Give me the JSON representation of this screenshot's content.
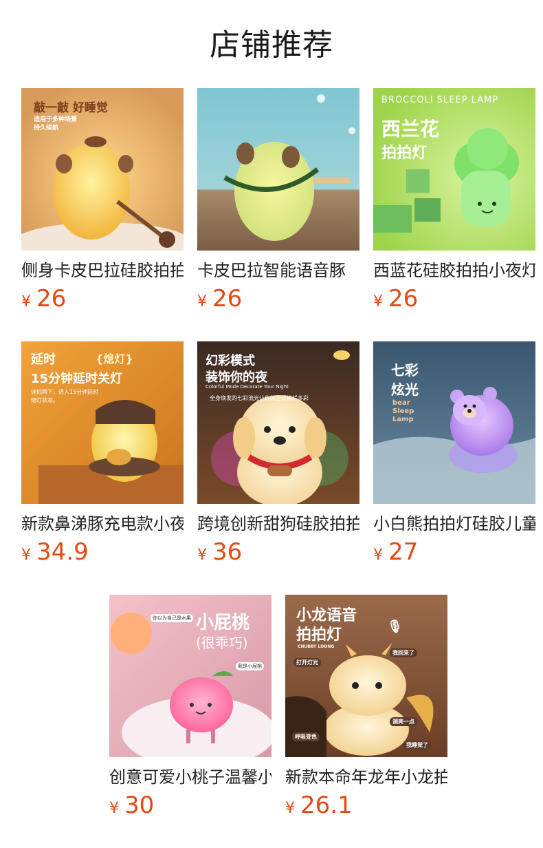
{
  "header": {
    "title": "店铺推荐"
  },
  "currency": "¥",
  "products": [
    {
      "name": "侧身卡皮巴拉硅胶拍拍灯",
      "price": "26",
      "image_text": {
        "headline": "敲一敲 好睡觉",
        "line1": "适用于多种场景",
        "line2": "持久续航"
      }
    },
    {
      "name": "卡皮巴拉智能语音豚",
      "price": "26"
    },
    {
      "name": "西蓝花硅胶拍拍小夜灯",
      "price": "26",
      "image_text": {
        "en": "BROCCOLI SLEEP LAMP",
        "line1": "西兰花",
        "line2": "拍拍灯"
      }
    },
    {
      "name": "新款鼻涕豚充电款小夜灯",
      "price": "34.9",
      "image_text": {
        "line1": "延时",
        "badge": "{熄灯}",
        "line2": "15分钟延时关灯",
        "line3": "连拍两下，进入15分钟延时",
        "line4": "熄灯状态。"
      }
    },
    {
      "name": "跨境创新甜狗硅胶拍拍灯",
      "price": "36",
      "image_text": {
        "line1": "幻彩模式",
        "line2": "装饰你的夜",
        "en": "Colorful Mode Decorate Your Night",
        "line3": "全身焕发的七彩流光让你的生活焕烂多彩"
      }
    },
    {
      "name": "小白熊拍拍灯硅胶儿童",
      "price": "27",
      "image_text": {
        "line1": "七彩",
        "line2": "炫光",
        "en1": "bear",
        "en2": "Sleep",
        "en3": "Lamp"
      }
    },
    {
      "name": "创意可爱小桃子温馨小夜灯",
      "price": "30",
      "image_text": {
        "line1": "小屁桃",
        "line2": "(很乖巧)",
        "bubble1": "你以为自己是水果",
        "bubble2": "我是小屁桃"
      }
    },
    {
      "name": "新款本命年龙年小龙拍拍灯",
      "price": "26.1",
      "image_text": {
        "line1": "小龙语音",
        "line2": "拍拍灯",
        "en": "CHUBBY LOONG",
        "tag1": "打开灯光",
        "tag2": "我回来了",
        "tag3": "调亮一点",
        "tag4": "呼吸变色",
        "tag5": "我睡觉了"
      }
    }
  ]
}
